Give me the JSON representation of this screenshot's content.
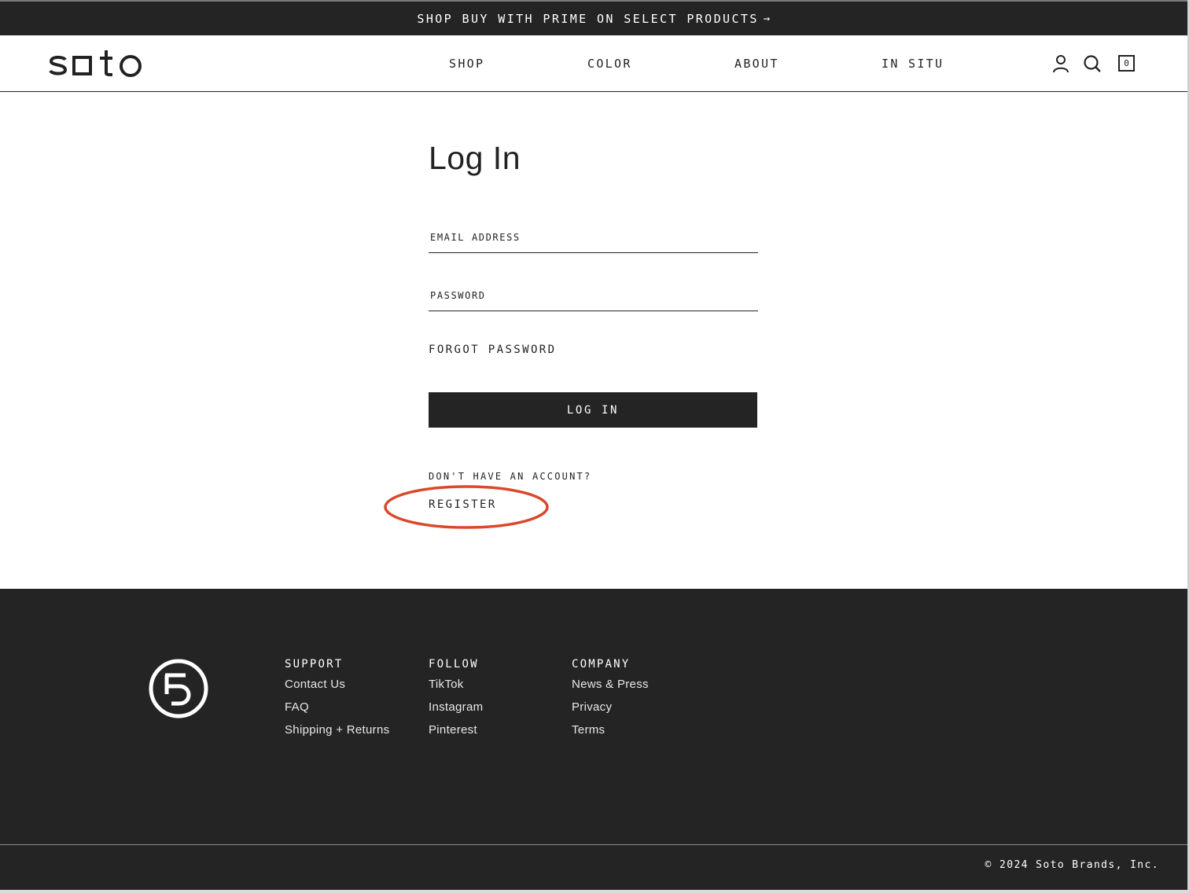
{
  "announcement": {
    "text": "SHOP BUY WITH PRIME ON SELECT PRODUCTS",
    "arrow": "→"
  },
  "header": {
    "logo_text": "soto",
    "nav": [
      {
        "label": "SHOP"
      },
      {
        "label": "COLOR"
      },
      {
        "label": "ABOUT"
      },
      {
        "label": "IN SITU"
      }
    ],
    "cart_count": "0"
  },
  "login": {
    "title": "Log In",
    "email_placeholder": "EMAIL ADDRESS",
    "password_placeholder": "PASSWORD",
    "forgot_label": "FORGOT PASSWORD",
    "submit_label": "LOG IN",
    "no_account_text": "DON'T HAVE AN ACCOUNT?",
    "register_label": "REGISTER"
  },
  "footer": {
    "columns": [
      {
        "title": "SUPPORT",
        "links": [
          "Contact Us",
          "FAQ",
          "Shipping + Returns"
        ]
      },
      {
        "title": "FOLLOW",
        "links": [
          "TikTok",
          "Instagram",
          "Pinterest"
        ]
      },
      {
        "title": "COMPANY",
        "links": [
          "News & Press",
          "Privacy",
          "Terms"
        ]
      }
    ],
    "copyright": "© 2024 Soto Brands, Inc."
  },
  "colors": {
    "dark": "#242424",
    "text": "#222222",
    "annotation": "#d9492c"
  },
  "icons": [
    "account-icon",
    "search-icon",
    "cart-icon",
    "arrow-right-icon",
    "footer-logo-icon"
  ]
}
